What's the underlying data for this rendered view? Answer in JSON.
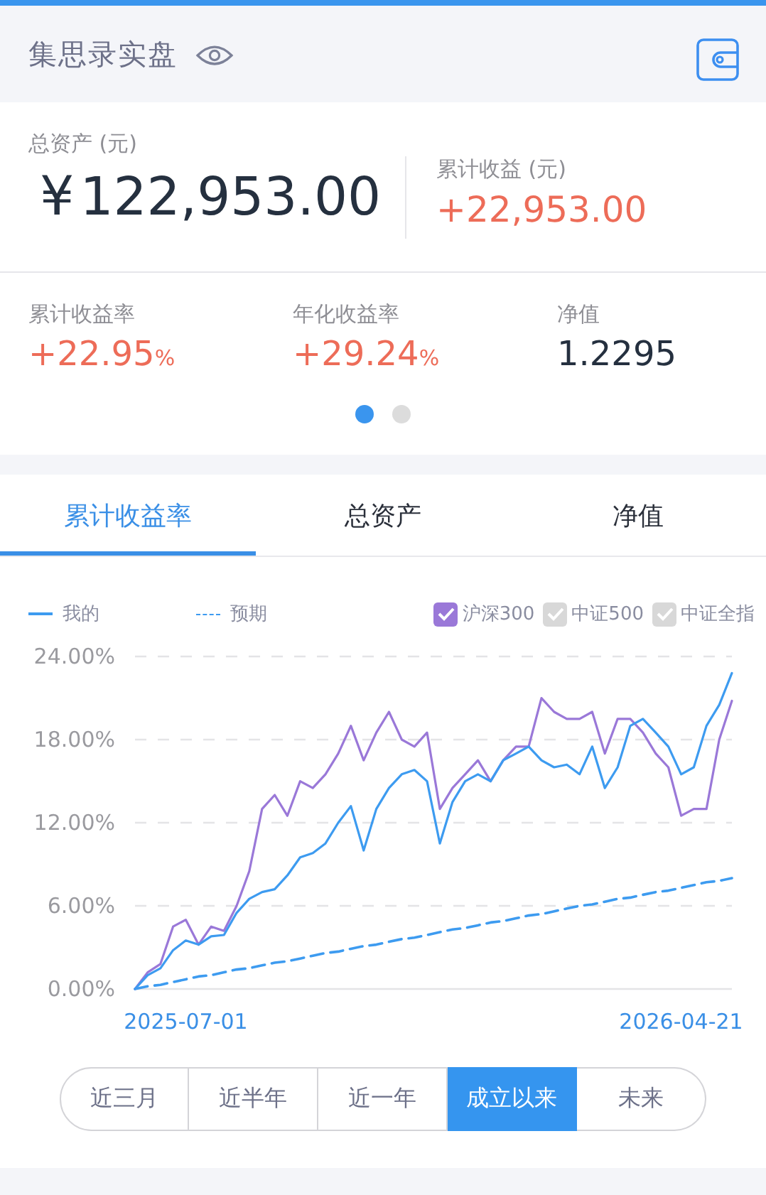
{
  "header": {
    "title": "集思录实盘"
  },
  "summary": {
    "total_label": "总资产 (元)",
    "currency": "¥",
    "total": "122,953.00",
    "profit_label": "累计收益 (元)",
    "profit": "+22,953.00"
  },
  "metrics": [
    {
      "label": "累计收益率",
      "value": "+22.95",
      "unit": "%",
      "kind": "gain"
    },
    {
      "label": "年化收益率",
      "value": "+29.24",
      "unit": "%",
      "kind": "gain"
    },
    {
      "label": "净值",
      "value": "1.2295",
      "kind": "plain"
    }
  ],
  "pager": [
    {
      "selected": true
    },
    {
      "selected": false
    }
  ],
  "tabs": [
    {
      "label": "累计收益率",
      "selected": true
    },
    {
      "label": "总资产",
      "selected": false
    },
    {
      "label": "净值",
      "selected": false
    }
  ],
  "benchmarks": [
    {
      "checked": true
    },
    {
      "label": "中证500",
      "checked": false
    },
    {
      "label": "中证全指",
      "checked": false
    }
  ],
  "chart_data": {
    "type": "line",
    "grid": true,
    "yticks": [
      {
        "value": 0,
        "label": "0.00%"
      },
      {
        "value": 6,
        "label": "6.00%"
      },
      {
        "value": 12,
        "label": "12.00%"
      },
      {
        "value": 18,
        "label": "18.00%"
      },
      {
        "value": 24,
        "label": "24.00%"
      }
    ],
    "ylim": [
      0,
      24
    ],
    "categories": [
      null,
      null,
      null,
      null,
      "2025-07-01",
      null,
      null,
      null,
      null,
      null,
      null,
      null,
      null,
      null,
      null,
      null,
      null,
      null,
      null,
      null,
      null,
      null,
      null,
      null,
      null,
      null,
      null,
      null,
      null,
      null,
      null,
      null,
      null,
      null,
      null,
      null,
      null,
      null,
      null,
      null,
      null,
      null,
      null,
      "2026-04-21",
      null,
      null,
      null,
      null
    ],
    "series": [
      {
        "name": "我的",
        "color": "#3d9bf0",
        "values": [
          0,
          1,
          1.5,
          2.8,
          3.5,
          3.2,
          3.8,
          3.9,
          5.5,
          6.5,
          7,
          7.2,
          8.2,
          9.5,
          9.8,
          10.5,
          12,
          13.2,
          10,
          13,
          14.5,
          15.5,
          15.8,
          15,
          10.5,
          13.5,
          15,
          15.5,
          15,
          16.5,
          17,
          17.5,
          16.5,
          16,
          16.2,
          15.5,
          17.5,
          14.5,
          16,
          19,
          19.5,
          18.5,
          17.5,
          15.5,
          16,
          19,
          20.5,
          22.8
        ]
      },
      {
        "name": "预期",
        "color": "#3d9bf0",
        "line_style": "dashed",
        "values": [
          0,
          0.2,
          0.3,
          0.5,
          0.7,
          0.9,
          1,
          1.2,
          1.4,
          1.5,
          1.7,
          1.9,
          2,
          2.2,
          2.4,
          2.6,
          2.7,
          2.9,
          3.1,
          3.2,
          3.4,
          3.6,
          3.7,
          3.9,
          4.1,
          4.3,
          4.4,
          4.6,
          4.8,
          4.9,
          5.1,
          5.3,
          5.4,
          5.6,
          5.8,
          6,
          6.1,
          6.3,
          6.5,
          6.6,
          6.8,
          7,
          7.1,
          7.3,
          7.5,
          7.7,
          7.8,
          8
        ]
      },
      {
        "name": "沪深300",
        "color": "#9a78d8",
        "values": [
          0,
          1.2,
          1.8,
          4.5,
          5,
          3.2,
          4.5,
          4.2,
          6,
          8.5,
          13,
          14,
          12.5,
          15,
          14.5,
          15.5,
          17,
          19,
          16.5,
          18.5,
          20,
          18,
          17.5,
          18.5,
          13,
          14.5,
          15.5,
          16.5,
          15,
          16.5,
          17.5,
          17.5,
          21,
          20,
          19.5,
          19.5,
          20,
          17,
          19.5,
          19.5,
          18.5,
          17,
          16,
          12.5,
          13,
          13,
          18,
          20.8
        ]
      }
    ]
  },
  "ranges": [
    {
      "label": "近三月",
      "selected": false
    },
    {
      "label": "近半年",
      "selected": false
    },
    {
      "label": "近一年",
      "selected": false
    },
    {
      "label": "成立以来",
      "selected": true
    },
    {
      "label": "未来",
      "selected": false
    }
  ]
}
